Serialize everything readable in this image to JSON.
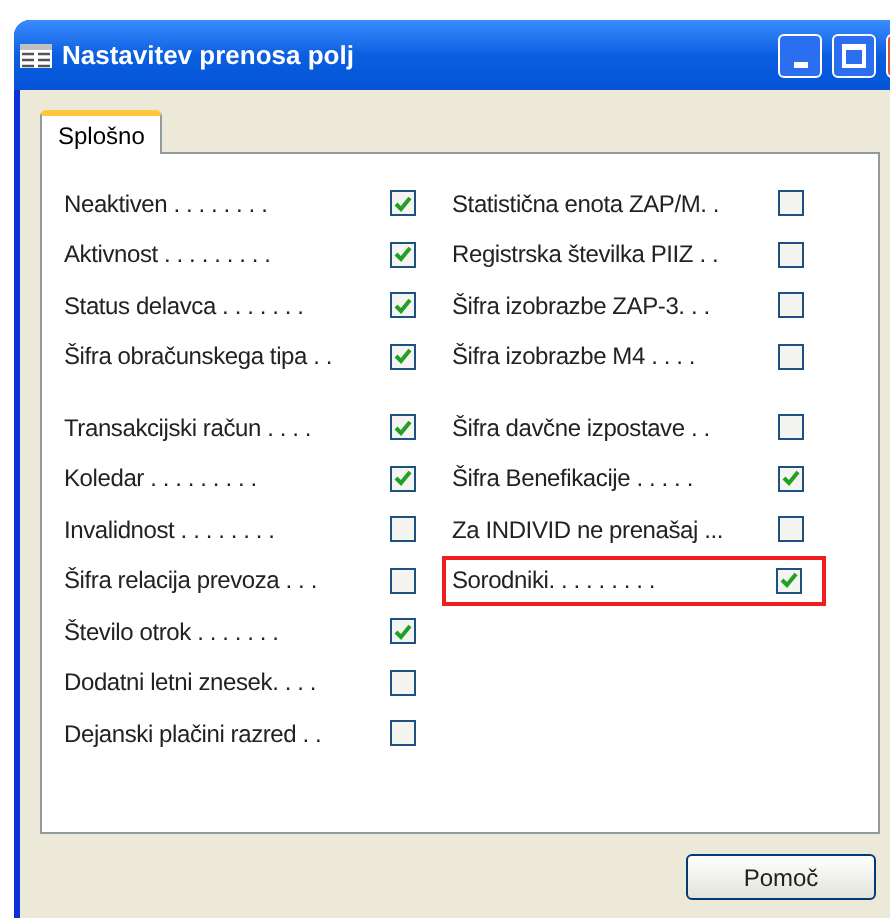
{
  "window": {
    "title": "Nastavitev prenosa polj"
  },
  "tabs": [
    {
      "label": "Splošno",
      "selected": true
    }
  ],
  "columns": [
    [
      [
        {
          "label": "Neaktiven . . . . . . . .",
          "checked": true,
          "highlighted": false
        },
        {
          "label": "Aktivnost . . . . . . . . .",
          "checked": true,
          "highlighted": false
        },
        {
          "label": "Status delavca . . . . . . .",
          "checked": true,
          "highlighted": false
        },
        {
          "label": "Šifra obračunskega tipa . .",
          "checked": true,
          "highlighted": false
        }
      ],
      [
        {
          "label": "Transakcijski račun . . . .",
          "checked": true,
          "highlighted": false
        },
        {
          "label": "Koledar . . . . . . . . .",
          "checked": true,
          "highlighted": false
        },
        {
          "label": "Invalidnost . . . . . . . .",
          "checked": false,
          "highlighted": false
        },
        {
          "label": "Šifra relacija prevoza . . .",
          "checked": false,
          "highlighted": false
        },
        {
          "label": "Število otrok . . . . . . .",
          "checked": true,
          "highlighted": false
        },
        {
          "label": "Dodatni letni znesek. . . .",
          "checked": false,
          "highlighted": false
        },
        {
          "label": "Dejanski plačini razred . .",
          "checked": false,
          "highlighted": false
        }
      ]
    ],
    [
      [
        {
          "label": "Statistična enota ZAP/M. .",
          "checked": false,
          "highlighted": false
        },
        {
          "label": "Registrska številka PIIZ . .",
          "checked": false,
          "highlighted": false
        },
        {
          "label": "Šifra izobrazbe ZAP-3. . .",
          "checked": false,
          "highlighted": false
        },
        {
          "label": "Šifra izobrazbe M4 . . . .",
          "checked": false,
          "highlighted": false
        }
      ],
      [
        {
          "label": "Šifra davčne izpostave . .",
          "checked": false,
          "highlighted": false
        },
        {
          "label": "Šifra Benefikacije . . . . .",
          "checked": true,
          "highlighted": false
        },
        {
          "label": "Za INDIVID ne prenašaj ...",
          "checked": false,
          "highlighted": false
        },
        {
          "label": "Sorodniki. . . . . . . . .",
          "checked": true,
          "highlighted": true
        }
      ]
    ]
  ],
  "buttons": [
    "Pomoč"
  ]
}
